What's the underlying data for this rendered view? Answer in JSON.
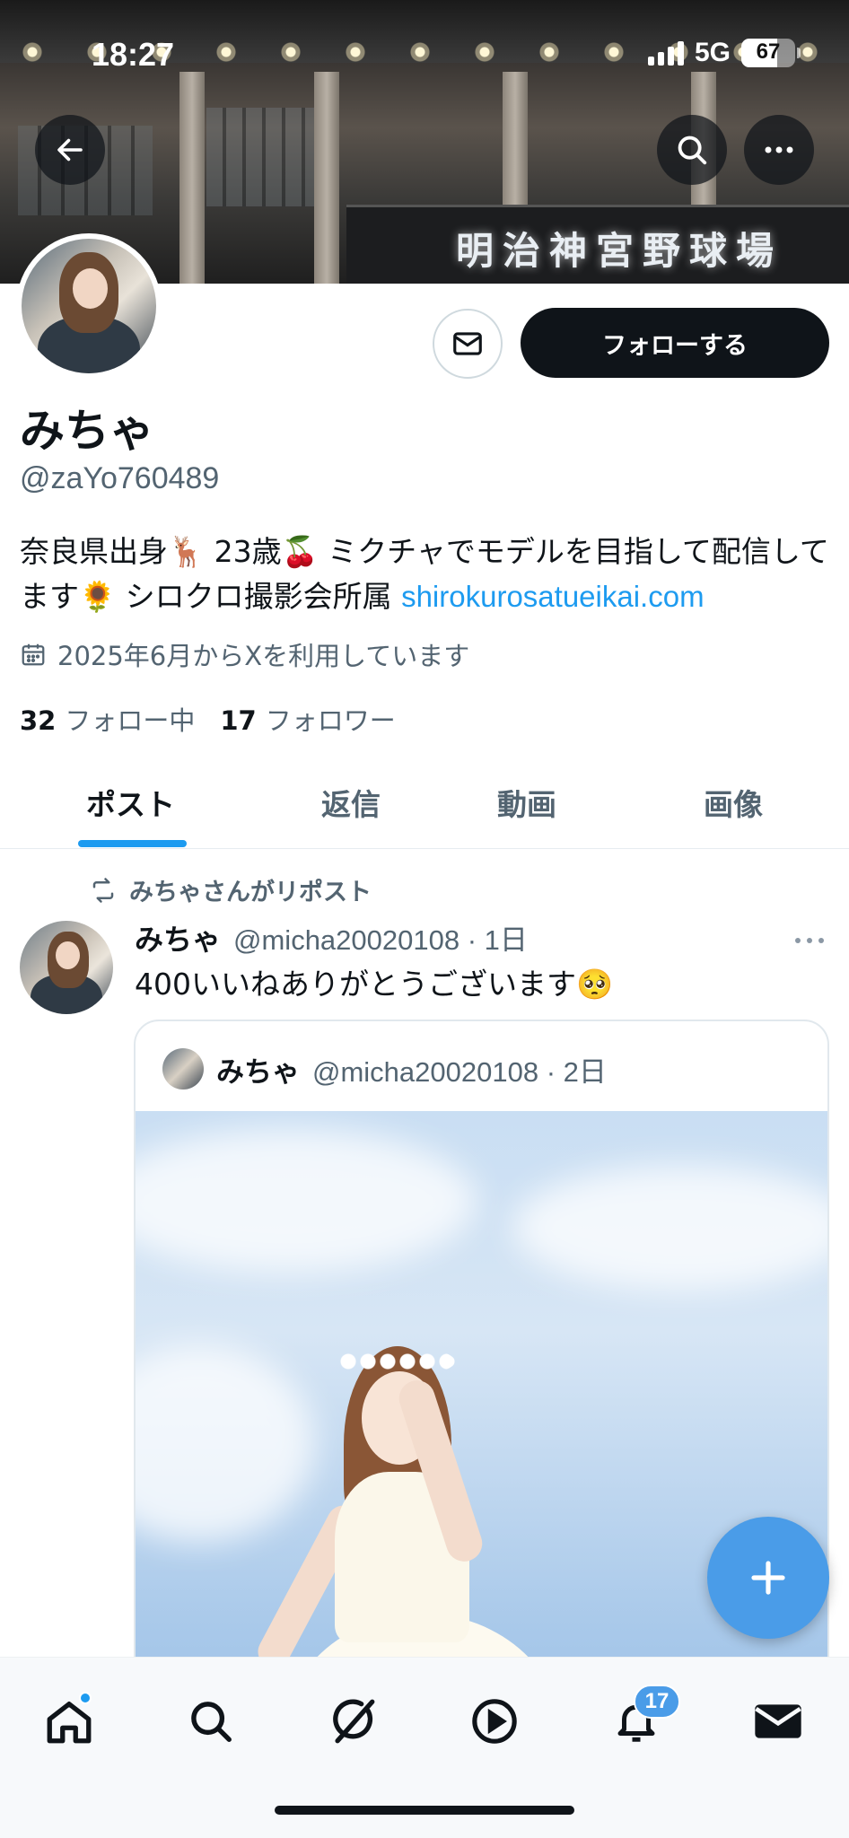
{
  "status_bar": {
    "time": "18:27",
    "network": "5G",
    "battery": 67,
    "battery_level_percent": 67
  },
  "banner": {
    "sign_text": "明治神宮野球場"
  },
  "profile": {
    "name": "みちゃ",
    "handle": "@zaYo760489",
    "bio_text": "奈良県出身🦌 23歳🍒 ミクチャでモデルを目指して配信してます🌻 シロクロ撮影会所属 ",
    "bio_link": "shirokurosatueikai.com",
    "joined": "2025年6月からXを利用しています",
    "following_count": "32",
    "following_label": "フォロー中",
    "followers_count": "17",
    "followers_label": "フォロワー",
    "follow_button": "フォローする"
  },
  "tabs": [
    {
      "label": "ポスト",
      "active": true
    },
    {
      "label": "返信",
      "active": false
    },
    {
      "label": "動画",
      "active": false
    },
    {
      "label": "画像",
      "active": false
    }
  ],
  "post": {
    "repost_label": "みちゃさんがリポスト",
    "author_name": "みちゃ",
    "author_handle": "@micha20020108",
    "time": "· 1日",
    "text": "400いいねありがとうございます🥺",
    "quote": {
      "author_name": "みちゃ",
      "author_handle": "@micha20020108",
      "time": "· 2日"
    }
  },
  "bottom_nav": {
    "items": [
      "home-icon",
      "search-icon",
      "grok-icon",
      "video-icon",
      "notifications-icon",
      "messages-icon"
    ],
    "notifications_badge": "17"
  },
  "colors": {
    "accent": "#1d9bf0",
    "fab": "#4a9ce8",
    "text": "#0f1419",
    "secondary": "#536471"
  }
}
